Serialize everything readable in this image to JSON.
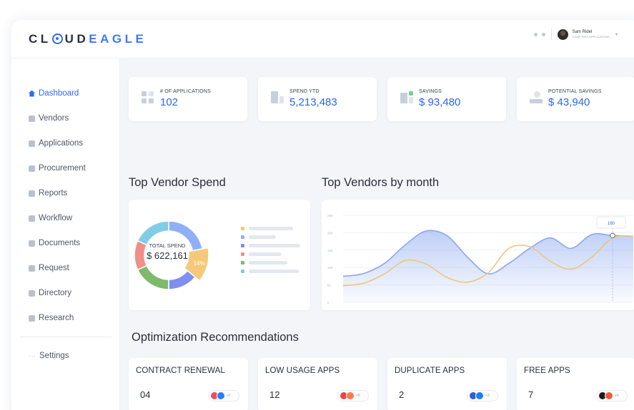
{
  "brand": {
    "prefix": "CL",
    "middle": "UD",
    "suffix": "EAGLE"
  },
  "user": {
    "name": "Sam Ridel",
    "role": "CHIEF INFO APPLICATIONS"
  },
  "sidebar": {
    "items": [
      {
        "label": "Dashboard",
        "icon": "home-icon",
        "active": true
      },
      {
        "label": "Vendors",
        "icon": "vendors-icon"
      },
      {
        "label": "Applications",
        "icon": "grid-icon"
      },
      {
        "label": "Procurement",
        "icon": "procurement-icon"
      },
      {
        "label": "Reports",
        "icon": "report-icon"
      },
      {
        "label": "Workflow",
        "icon": "workflow-icon"
      },
      {
        "label": "Documents",
        "icon": "folder-icon"
      },
      {
        "label": "Request",
        "icon": "request-icon"
      },
      {
        "label": "Directory",
        "icon": "directory-icon"
      },
      {
        "label": "Research",
        "icon": "research-icon"
      }
    ],
    "settings": {
      "label": "Settings",
      "icon": "more-icon"
    }
  },
  "stats": [
    {
      "label": "# OF APPLICATIONS",
      "value": "102",
      "icon": "apps-icon"
    },
    {
      "label": "SPEND YTD",
      "value": "5,213,483",
      "icon": "spend-icon"
    },
    {
      "label": "SAVINGS",
      "value": "$ 93,480",
      "icon": "savings-icon"
    },
    {
      "label": "POTENTIAL SAVINGS",
      "value": "$ 43,940",
      "icon": "potential-savings-icon"
    }
  ],
  "sections": {
    "top_vendor_spend": "Top Vendor Spend",
    "top_vendors_month": "Top Vendors by month",
    "optimization": "Optimization Recommendations"
  },
  "donut": {
    "center_label": "TOTAL SPEND",
    "center_value": "$ 622,161",
    "highlight_label": "14%",
    "segments": [
      {
        "color": "#8fb0f7",
        "value": 22
      },
      {
        "color": "#f6c97a",
        "value": 14
      },
      {
        "color": "#7f8ef2",
        "value": 14
      },
      {
        "color": "#7dba6b",
        "value": 18
      },
      {
        "color": "#ee8f8a",
        "value": 14
      },
      {
        "color": "#82cde6",
        "value": 18
      }
    ],
    "legend_colors": [
      "#f6c97a",
      "#8fb0f7",
      "#7f8ef2",
      "#ee8f8a",
      "#7dba6b",
      "#82cde6"
    ]
  },
  "chart_data": {
    "type": "area",
    "title": "Top Vendors by month",
    "y_ticks": [
      "250",
      "200",
      "150",
      "100",
      "50",
      "0"
    ],
    "tooltip": "180",
    "ylim": [
      0,
      250
    ],
    "series": [
      {
        "color": "#8aa7ef",
        "values": [
          75,
          83,
          112,
          165,
          205,
          192,
          130,
          82,
          112,
          155,
          185,
          155,
          195,
          192,
          190
        ]
      },
      {
        "color": "#ecc67e",
        "values": [
          48,
          55,
          82,
          120,
          110,
          72,
          58,
          85,
          155,
          160,
          118,
          95,
          130,
          185,
          190
        ]
      }
    ]
  },
  "recommendations": [
    {
      "title": "CONTRACT RENEWAL",
      "count": "04",
      "more": "+2",
      "apps": [
        "#e8506a",
        "#2d7cf6"
      ]
    },
    {
      "title": "LOW USAGE APPS",
      "count": "12",
      "more": "+8",
      "apps": [
        "#e54848",
        "#ff7a45"
      ]
    },
    {
      "title": "DUPLICATE APPS",
      "count": "2",
      "more": "+3",
      "apps": [
        "#2b5fd9",
        "#1e7ef0"
      ]
    },
    {
      "title": "FREE APPS",
      "count": "7",
      "more": "+6",
      "apps": [
        "#1b1b1b",
        "#ef5a3c"
      ]
    }
  ]
}
